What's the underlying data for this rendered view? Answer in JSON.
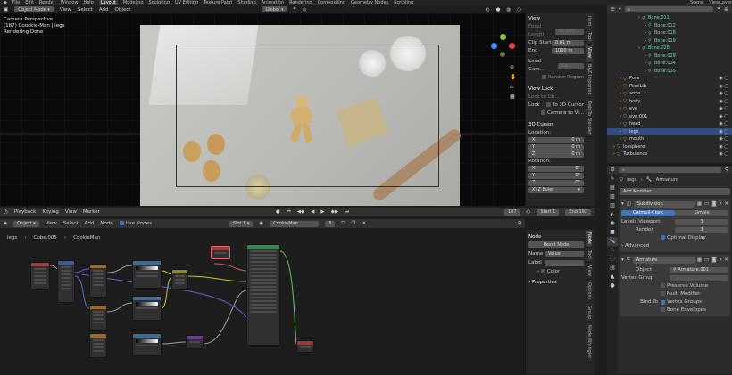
{
  "topbar": {
    "menus": [
      "File",
      "Edit",
      "Render",
      "Window",
      "Help"
    ],
    "workspaces": [
      "Layout",
      "Modeling",
      "Sculpting",
      "UV Editing",
      "Texture Paint",
      "Shading",
      "Animation",
      "Rendering",
      "Compositing",
      "Geometry Nodes",
      "Scripting"
    ],
    "active_workspace": "Layout",
    "scene": "Scene",
    "view_layer": "ViewLayer"
  },
  "viewport": {
    "mode": "Object Mode",
    "menus": [
      "View",
      "Select",
      "Add",
      "Object"
    ],
    "transform": "Global",
    "info_line1": "Camera Perspective",
    "info_line2": "(187) Coockie-Man | legs",
    "info_line3": "Rendering Done"
  },
  "npanel": {
    "view_title": "View",
    "focal_label": "Focal Length",
    "focal_value": "50 mm",
    "clip_start_label": "Clip Start",
    "clip_start_value": "0.01 m",
    "end_label": "End",
    "end_value": "1000 m",
    "local_cam_label": "Local Cam...",
    "local_cam_value": "Ca...",
    "render_region": "Render Region",
    "view_lock_title": "View Lock",
    "lock_to_obj": "Lock to Ob...",
    "lock_label": "Lock",
    "to_3d_cursor": "To 3D Cursor",
    "camera_to_view": "Camera to Vi...",
    "cursor_title": "3D Cursor",
    "location_label": "Location:",
    "x_label": "X",
    "x_value": "0 m",
    "y_label": "Y",
    "y_value": "0 m",
    "z_label": "Z",
    "z_value": "0 m",
    "rotation_label": "Rotation:",
    "rx_value": "0°",
    "ry_value": "0°",
    "rz_value": "0°",
    "euler": "XYZ Euler",
    "tabs": [
      "Item",
      "Tool",
      "View",
      "BAZ Importer",
      "Dab To Blender"
    ]
  },
  "timeline": {
    "menus": [
      "Playback",
      "Keying",
      "View",
      "Marker"
    ],
    "current_frame": "187",
    "start_label": "Start",
    "start_value": "1",
    "end_label": "End",
    "end_value": "192"
  },
  "node_editor": {
    "type": "Object",
    "menus": [
      "View",
      "Select",
      "Add",
      "Node"
    ],
    "use_nodes": "Use Nodes",
    "slot": "Slot 1",
    "material": "CookieMan",
    "users": "8",
    "breadcrumb": [
      "legs",
      "Cube.005",
      "CookieMan"
    ]
  },
  "node_sidebar": {
    "node_title": "Node",
    "reset_node": "Reset Node",
    "name_label": "Name",
    "name_value": "Value",
    "label_label": "Label",
    "label_value": "",
    "color_label": "Color",
    "properties_title": "Properties",
    "tabs": [
      "Node",
      "Tool",
      "View",
      "Options",
      "Group",
      "Node Wrangler"
    ]
  },
  "outliner": {
    "items": [
      {
        "name": "Bone.011",
        "indent": 5,
        "selected": false
      },
      {
        "name": "Bone.012",
        "indent": 6,
        "selected": false
      },
      {
        "name": "Bone.018",
        "indent": 6,
        "selected": false
      },
      {
        "name": "Bone.019",
        "indent": 6,
        "selected": false
      },
      {
        "name": "Bone.028",
        "indent": 5,
        "selected": false
      },
      {
        "name": "Bone.029",
        "indent": 6,
        "selected": false
      },
      {
        "name": "Bone.034",
        "indent": 6,
        "selected": false
      },
      {
        "name": "Bone.035",
        "indent": 6,
        "selected": false
      },
      {
        "name": "Pose",
        "indent": 2,
        "selected": false
      },
      {
        "name": "PixelLib",
        "indent": 2,
        "selected": false
      },
      {
        "name": "arms",
        "indent": 2,
        "selected": false
      },
      {
        "name": "body",
        "indent": 2,
        "selected": false
      },
      {
        "name": "eye",
        "indent": 2,
        "selected": false
      },
      {
        "name": "eye.001",
        "indent": 2,
        "selected": false
      },
      {
        "name": "head",
        "indent": 2,
        "selected": false
      },
      {
        "name": "legs",
        "indent": 2,
        "selected": true
      },
      {
        "name": "mouth",
        "indent": 2,
        "selected": false
      },
      {
        "name": "Icosphere",
        "indent": 1,
        "selected": false
      },
      {
        "name": "Turbulence",
        "indent": 1,
        "selected": false
      }
    ]
  },
  "properties": {
    "object_name": "legs",
    "modifier_name": "Armature",
    "add_modifier": "Add Modifier",
    "subdivision_name": "Subdivision",
    "catmull_clark": "Catmull-Clark",
    "simple": "Simple",
    "levels_viewport_label": "Levels Viewport",
    "levels_viewport_value": "3",
    "render_label": "Render",
    "render_value": "3",
    "optimal_display": "Optimal Display",
    "advanced": "Advanced",
    "armature_name": "Armature",
    "object_label": "Object",
    "object_value": "Armature.001",
    "vertex_group_label": "Vertex Group",
    "preserve_volume": "Preserve Volume",
    "multi_modifier": "Multi Modifier",
    "bind_to_label": "Bind To",
    "vertex_groups": "Vertex Groups",
    "bone_envelopes": "Bone Envelopes"
  },
  "colors": {
    "accent": "#4772b3",
    "panel": "#303030",
    "background": "#1d1d1d"
  }
}
